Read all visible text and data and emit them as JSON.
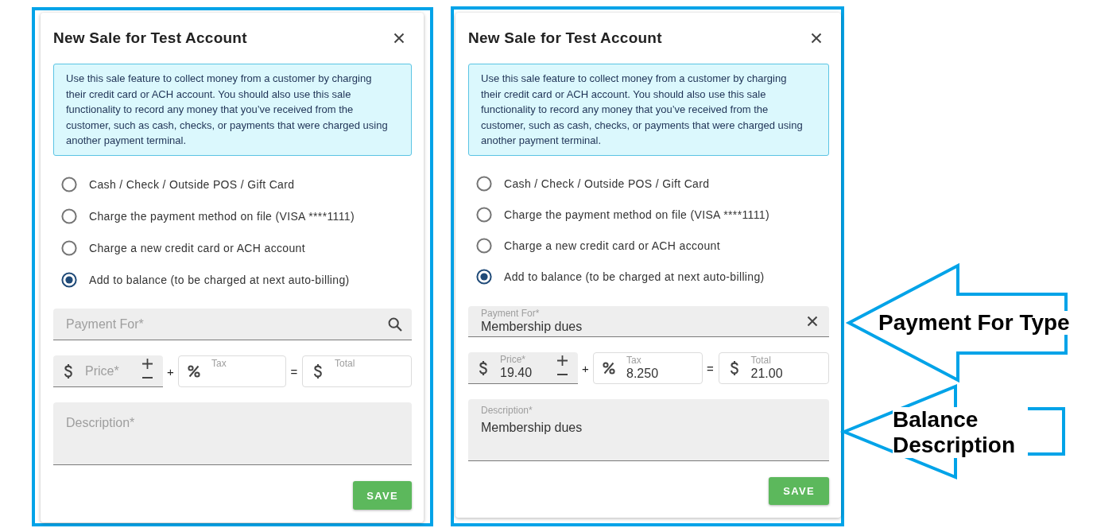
{
  "dialogs": [
    {
      "title": "New Sale for Test Account",
      "notice": "Use this sale feature to collect money from a customer by charging their credit card or ACH account. You should also use this sale functionality to record any money that you’ve received from the customer, such as cash, checks, or payments that were charged using another payment terminal.",
      "payment_options": [
        {
          "label": "Cash / Check / Outside POS / Gift Card",
          "selected": false
        },
        {
          "label": "Charge the payment method on file (VISA ****1111)",
          "selected": false
        },
        {
          "label": "Charge a new credit card or ACH account",
          "selected": false
        },
        {
          "label": "Add to balance (to be charged at next auto-billing)",
          "selected": true
        }
      ],
      "payment_for": {
        "placeholder": "Payment For*"
      },
      "price": {
        "placeholder": "Price*"
      },
      "plus": "+",
      "tax": {
        "label": "Tax"
      },
      "equals": "=",
      "total": {
        "label": "Total"
      },
      "description": {
        "placeholder": "Description*"
      },
      "save_button": "SAVE"
    },
    {
      "title": "New Sale for Test Account",
      "notice": "Use this sale feature to collect money from a customer by charging their credit card or ACH account. You should also use this sale functionality to record any money that you’ve received from the customer, such as cash, checks, or payments that were charged using another payment terminal.",
      "payment_options": [
        {
          "label": "Cash / Check / Outside POS / Gift Card",
          "selected": false
        },
        {
          "label": "Charge the payment method on file (VISA ****1111)",
          "selected": false
        },
        {
          "label": "Charge a new credit card or ACH account",
          "selected": false
        },
        {
          "label": "Add to balance (to be charged at next auto-billing)",
          "selected": true
        }
      ],
      "payment_for": {
        "label": "Payment For*",
        "value": "Membership dues"
      },
      "price": {
        "label": "Price*",
        "value": "19.40"
      },
      "plus": "+",
      "tax": {
        "label": "Tax",
        "value": "8.250"
      },
      "equals": "=",
      "total": {
        "label": "Total",
        "value": "21.00"
      },
      "description": {
        "label": "Description*",
        "value": "Membership dues"
      },
      "save_button": "SAVE"
    }
  ],
  "callouts": [
    {
      "text": "Payment For Type"
    },
    {
      "text": "Balance Description"
    }
  ]
}
